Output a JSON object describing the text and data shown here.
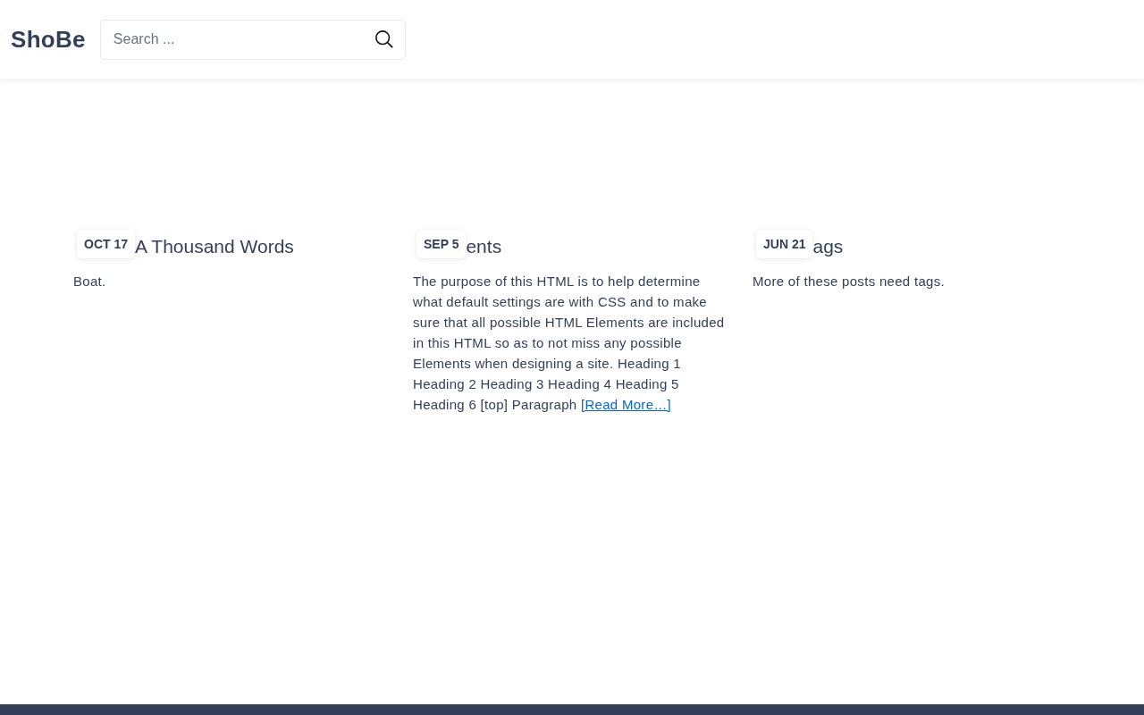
{
  "header": {
    "logo": "ShoBe",
    "search": {
      "placeholder": "Search ..."
    }
  },
  "posts": [
    {
      "date": "OCT 17",
      "title": "A Thousand Words",
      "excerpt": "Boat."
    },
    {
      "date": "SEP 5",
      "title": "ents",
      "excerpt": "The purpose of this HTML is to help determine what default settings are with CSS and to make sure that all possible HTML Elements are included in this HTML so as to not miss any possible Elements when designing a site. Heading 1 Heading 2 Heading 3 Heading 4 Heading 5 Heading 6 [top] Paragraph",
      "link": "[Read More…]"
    },
    {
      "date": "JUN 21",
      "title": "ags",
      "excerpt": "More of these posts need tags."
    }
  ]
}
